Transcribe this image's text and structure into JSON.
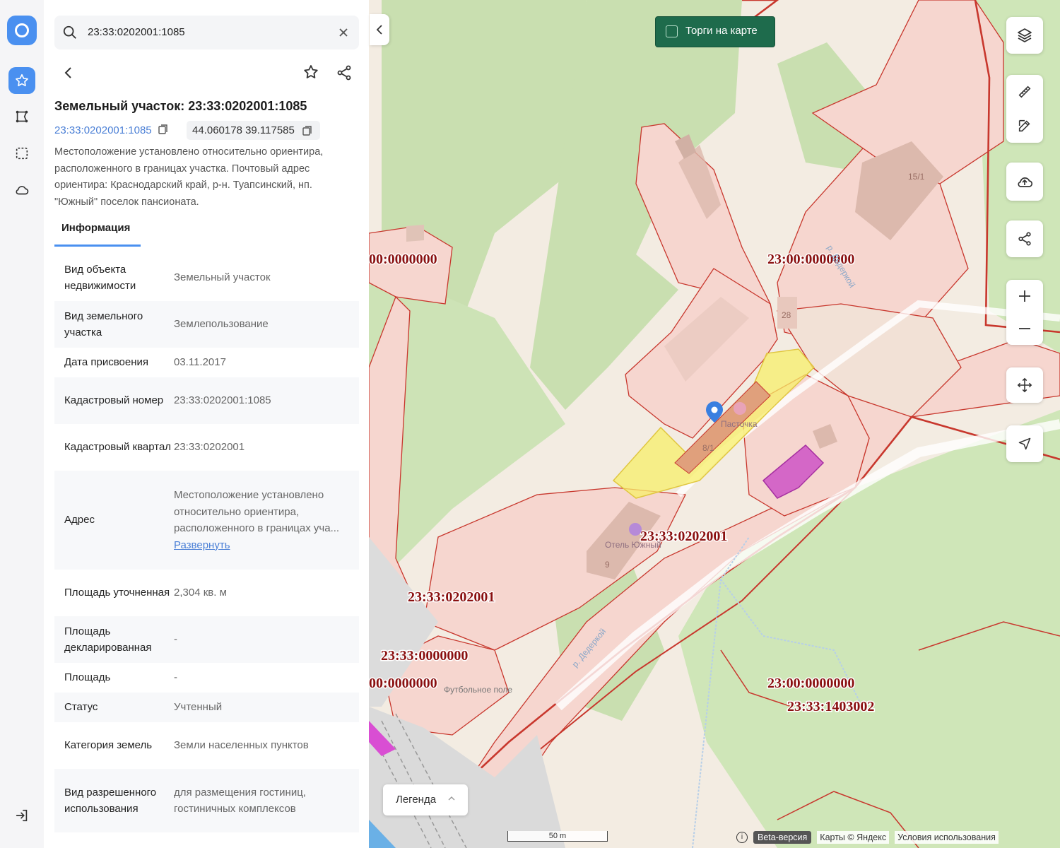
{
  "search": {
    "value": "23:33:0202001:1085"
  },
  "object": {
    "title": "Земельный участок: 23:33:0202001:1085",
    "cadastral_link": "23:33:0202001:1085",
    "coordinates": "44.060178 39.117585",
    "description": "Местоположение установлено относительно ориентира, расположенного в границах участка. Почтовый адрес ориентира: Краснодарский край, р-н. Туапсинский, нп. \"Южный\" поселок пансионата."
  },
  "tabs": {
    "info": "Информация"
  },
  "info_rows": [
    {
      "label": "Вид объекта недвижимости",
      "value": "Земельный участок"
    },
    {
      "label": "Вид земельного участка",
      "value": "Землепользование"
    },
    {
      "label": "Дата присвоения",
      "value": "03.11.2017"
    },
    {
      "label": "Кадастровый номер",
      "value": "23:33:0202001:1085"
    },
    {
      "label": "Кадастровый квартал",
      "value": "23:33:0202001"
    },
    {
      "label": "Адрес",
      "value": "Местоположение установлено относительно ориентира, расположенного в границах уча...",
      "link": "Развернуть"
    },
    {
      "label": "Площадь уточненная",
      "value": "2,304 кв. м"
    },
    {
      "label": "Площадь декларированная",
      "value": "-"
    },
    {
      "label": "Площадь",
      "value": "-"
    },
    {
      "label": "Статус",
      "value": "Учтенный"
    },
    {
      "label": "Категория земель",
      "value": "Земли населенных пунктов"
    },
    {
      "label": "Вид разрешенного использования",
      "value": "для размещения гостиниц, гостиничных комплексов"
    }
  ],
  "map": {
    "torgi_label": "Торги на карте",
    "legend_label": "Легенда",
    "scale_label": "50 m",
    "beta_label": "Beta-версия",
    "attribution": "Карты © Яндекс",
    "terms": "Условия использования",
    "labels": [
      {
        "text": "00:0000000"
      },
      {
        "text": "23:00:0000000"
      },
      {
        "text": "23:33:0202001"
      },
      {
        "text": "23:33:0202001"
      },
      {
        "text": "23:33:0000000"
      },
      {
        "text": "00:0000000"
      },
      {
        "text": "23:00:0000000"
      },
      {
        "text": "23:33:1403002"
      }
    ],
    "poi": {
      "cafe": "Пасточка",
      "hotel": "Отель Южный",
      "field": "Футбольное поле",
      "river1": "р. Дедеркой",
      "river2": "р. Дедеркой",
      "house_15": "15/1",
      "house_28": "28",
      "house_9": "9",
      "house_8": "8/1"
    }
  },
  "colors": {
    "accent": "#4a90f0",
    "parcel_line": "#c8372d",
    "selected_fill": "#f7ef6a",
    "torgi_bg": "#1e6b4c"
  }
}
